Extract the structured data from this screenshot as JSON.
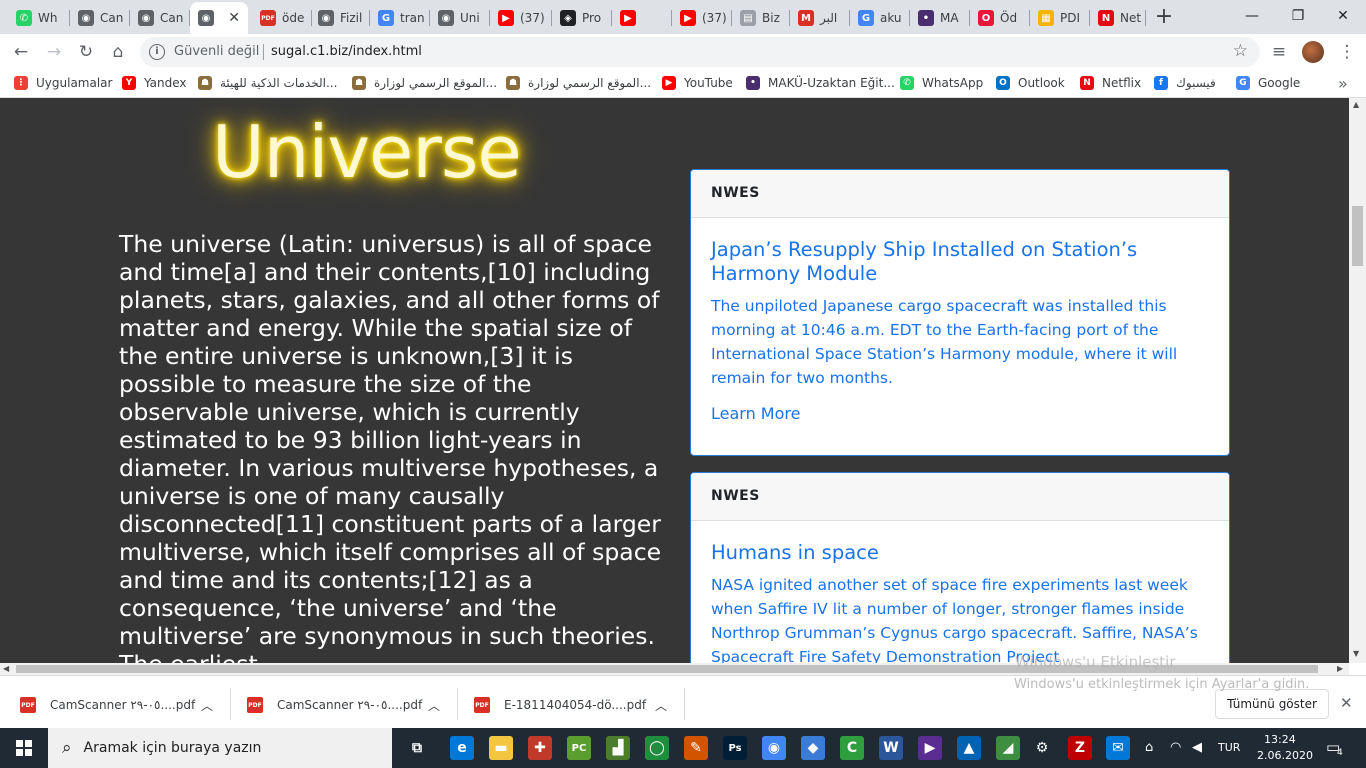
{
  "tabs": [
    {
      "label": "Wh",
      "icon": "whatsapp-icon",
      "color": "#25d366",
      "glyph": "✆"
    },
    {
      "label": "Can",
      "icon": "globe-icon",
      "color": "#5f6368",
      "glyph": "◉"
    },
    {
      "label": "Can",
      "icon": "globe-icon",
      "color": "#5f6368",
      "glyph": "◉"
    },
    {
      "label": "",
      "icon": "globe-icon",
      "color": "#5f6368",
      "glyph": "◉",
      "active": true
    },
    {
      "label": "öde",
      "icon": "pdf-icon",
      "color": "#d93025",
      "glyph": "PDF"
    },
    {
      "label": "Fizil",
      "icon": "globe-icon",
      "color": "#5f6368",
      "glyph": "◉"
    },
    {
      "label": "tran",
      "icon": "google-icon",
      "color": "#4285f4",
      "glyph": "G"
    },
    {
      "label": "Uni",
      "icon": "globe-icon",
      "color": "#5f6368",
      "glyph": "◉"
    },
    {
      "label": "(37)",
      "icon": "youtube-icon",
      "color": "#ff0000",
      "glyph": "▶"
    },
    {
      "label": "Pro",
      "icon": "app-icon",
      "color": "#202124",
      "glyph": "◈"
    },
    {
      "label": "",
      "icon": "youtube-icon",
      "color": "#ff0000",
      "glyph": "▶"
    },
    {
      "label": "(37)",
      "icon": "youtube-icon",
      "color": "#ff0000",
      "glyph": "▶"
    },
    {
      "label": "Biz",
      "icon": "page-icon",
      "color": "#9aa0a6",
      "glyph": "▤"
    },
    {
      "label": "البر",
      "icon": "gmail-icon",
      "color": "#d93025",
      "glyph": "M"
    },
    {
      "label": "aku",
      "icon": "google-icon",
      "color": "#4285f4",
      "glyph": "G"
    },
    {
      "label": "MA",
      "icon": "maku-icon",
      "color": "#4a2d6e",
      "glyph": "•"
    },
    {
      "label": "Öd",
      "icon": "opera-icon",
      "color": "#e8173a",
      "glyph": "O"
    },
    {
      "label": "PDI",
      "icon": "pdf-tool-icon",
      "color": "#f4b400",
      "glyph": "▦"
    },
    {
      "label": "Net",
      "icon": "netflix-icon",
      "color": "#e50914",
      "glyph": "N"
    }
  ],
  "window": {
    "minimize": "—",
    "maximize": "❐",
    "close": "✕"
  },
  "address": {
    "security": "Güvenli değil",
    "url": "sugal.c1.biz/index.html"
  },
  "bookmarks": [
    {
      "label": "Uygulamalar",
      "icon": "apps-grid-icon",
      "color": "#ea4335",
      "glyph": "⋮"
    },
    {
      "label": "Yandex",
      "icon": "yandex-icon",
      "color": "#ff0000",
      "glyph": "Y"
    },
    {
      "label": "الخدمات الذكية للهيئة...",
      "icon": "emblem-icon",
      "color": "#8a6d3b",
      "glyph": "☗"
    },
    {
      "label": "الموقع الرسمي لوزارة...",
      "icon": "emblem-icon",
      "color": "#8a6d3b",
      "glyph": "☗"
    },
    {
      "label": "الموقع الرسمي لوزارة...",
      "icon": "emblem-icon",
      "color": "#8a6d3b",
      "glyph": "☗"
    },
    {
      "label": "YouTube",
      "icon": "youtube-icon",
      "color": "#ff0000",
      "glyph": "▶"
    },
    {
      "label": "MAKÜ-Uzaktan Eğit...",
      "icon": "maku-icon",
      "color": "#4a2d6e",
      "glyph": "•"
    },
    {
      "label": "WhatsApp",
      "icon": "whatsapp-icon",
      "color": "#25d366",
      "glyph": "✆"
    },
    {
      "label": "Outlook",
      "icon": "outlook-icon",
      "color": "#0072c6",
      "glyph": "O"
    },
    {
      "label": "Netflix",
      "icon": "netflix-icon",
      "color": "#e50914",
      "glyph": "N"
    },
    {
      "label": "فيسبوك",
      "icon": "facebook-icon",
      "color": "#1877f2",
      "glyph": "f"
    },
    {
      "label": "Google",
      "icon": "google-icon",
      "color": "#4285f4",
      "glyph": "G"
    }
  ],
  "page": {
    "title": "Universe",
    "body": "The universe (Latin: universus) is all of space and time[a] and their contents,[10] including planets, stars, galaxies, and all other forms of matter and energy. While the spatial size of the entire universe is unknown,[3] it is possible to measure the size of the observable universe, which is currently estimated to be 93 billion light-years in diameter. In various multiverse hypotheses, a universe is one of many causally disconnected[11] constituent parts of a larger multiverse, which itself comprises all of space and time and its contents;[12] as a consequence, ‘the universe’ and ‘the multiverse’ are synonymous in such theories. The earliest",
    "cards": [
      {
        "header": "NWES",
        "title": "Japan’s Resupply Ship Installed on Station’s Harmony Module",
        "text": "The unpiloted Japanese cargo spacecraft was installed this morning at 10:46 a.m. EDT to the Earth-facing port of the International Space Station’s Harmony module, where it will remain for two months.",
        "link": "Learn More"
      },
      {
        "header": "NWES",
        "title": "Humans in space",
        "text": "NASA ignited another set of space fire experiments last week when Saffire IV lit a number of longer, stronger flames inside Northrop Grumman’s Cygnus cargo spacecraft. Saffire, NASA’s Spacecraft Fire Safety Demonstration Project"
      }
    ]
  },
  "watermark": {
    "line1": "Windows'u Etkinleştir",
    "line2": "Windows'u etkinleştirmek için Ayarlar'a gidin."
  },
  "downloads": {
    "items": [
      {
        "name": "CamScanner ٠٥-٢٩....pdf"
      },
      {
        "name": "CamScanner ٠٥-٢٩....pdf"
      },
      {
        "name": "E-1811404054-dö....pdf"
      }
    ],
    "show_all": "Tümünü göster"
  },
  "taskbar": {
    "search_placeholder": "Aramak için buraya yazın",
    "apps": [
      {
        "icon": "task-view-icon",
        "color": "#1f2a35",
        "glyph": "⧉"
      },
      {
        "icon": "edge-icon",
        "color": "#0078d7",
        "glyph": "e"
      },
      {
        "icon": "file-explorer-icon",
        "color": "#f4c542",
        "glyph": "▬"
      },
      {
        "icon": "game-icon",
        "color": "#c0392b",
        "glyph": "✚"
      },
      {
        "icon": "pc-icon",
        "color": "#5a9e2f",
        "glyph": "PC"
      },
      {
        "icon": "app-icon",
        "color": "#4c7d2c",
        "glyph": "▟"
      },
      {
        "icon": "circle-app-icon",
        "color": "#1e8e3e",
        "glyph": "◯"
      },
      {
        "icon": "paint-icon",
        "color": "#d35400",
        "glyph": "✎"
      },
      {
        "icon": "photoshop-icon",
        "color": "#001e36",
        "glyph": "Ps"
      },
      {
        "icon": "chrome-icon",
        "color": "#4285f4",
        "glyph": "◉"
      },
      {
        "icon": "app-icon",
        "color": "#3a7bd5",
        "glyph": "◆"
      },
      {
        "icon": "camtasia-icon",
        "color": "#2e9e3e",
        "glyph": "C"
      },
      {
        "icon": "word-icon",
        "color": "#2b579a",
        "glyph": "W"
      },
      {
        "icon": "video-icon",
        "color": "#5c2d91",
        "glyph": "▶"
      },
      {
        "icon": "photos-icon",
        "color": "#0063b1",
        "glyph": "▲"
      },
      {
        "icon": "app-icon",
        "color": "#3e8e41",
        "glyph": "◢"
      },
      {
        "icon": "settings-icon",
        "color": "#1f2a35",
        "glyph": "⚙"
      },
      {
        "icon": "filezilla-icon",
        "color": "#bf0000",
        "glyph": "Z"
      },
      {
        "icon": "mail-icon",
        "color": "#0078d7",
        "glyph": "✉"
      }
    ],
    "lang": "TUR",
    "time": "13:24",
    "date": "2.06.2020",
    "notifications": "4"
  }
}
